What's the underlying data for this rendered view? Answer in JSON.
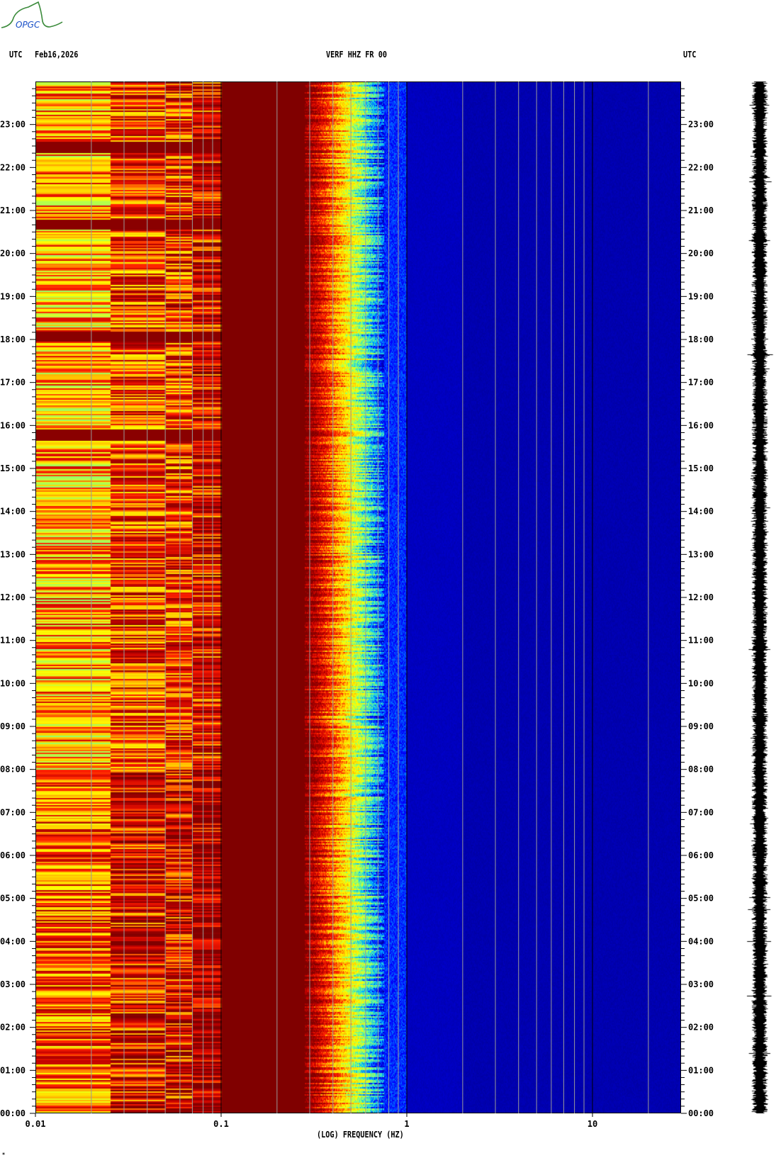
{
  "logo": {
    "text": "OPGC",
    "colors": {
      "curve": "#3a8a3a",
      "text": "#1a50c8"
    }
  },
  "header": {
    "left_tz": "UTC",
    "date": "Feb16,2026",
    "station": "VERF HHZ FR 00",
    "right_tz": "UTC"
  },
  "footer_mark": "*",
  "chart_data": {
    "type": "heatmap",
    "title": "VERF HHZ FR 00",
    "date": "Feb16,2026",
    "xlabel": "(LOG) FREQUENCY (HZ)",
    "xscale": "log",
    "xlim": [
      0.01,
      30
    ],
    "xticks": [
      {
        "value": 0.01,
        "label": "0.01"
      },
      {
        "value": 0.1,
        "label": "0.1"
      },
      {
        "value": 1,
        "label": "1"
      },
      {
        "value": 10,
        "label": "10"
      }
    ],
    "ylabel": "UTC",
    "ylim_hours": [
      0,
      24
    ],
    "yticks": [
      "00:00",
      "01:00",
      "02:00",
      "03:00",
      "04:00",
      "05:00",
      "06:00",
      "07:00",
      "08:00",
      "09:00",
      "10:00",
      "11:00",
      "12:00",
      "13:00",
      "14:00",
      "15:00",
      "16:00",
      "17:00",
      "18:00",
      "19:00",
      "20:00",
      "21:00",
      "22:00",
      "23:00"
    ],
    "minor_tick_minutes": 10,
    "colorscale": [
      "#0000a0",
      "#0000ff",
      "#00c0ff",
      "#80ff80",
      "#ffff00",
      "#ffc000",
      "#ff2000",
      "#c00000",
      "#800000"
    ],
    "bands": [
      {
        "fmin": 0.01,
        "fmax": 0.025,
        "level": 0.62
      },
      {
        "fmin": 0.025,
        "fmax": 0.05,
        "level": 0.74
      },
      {
        "fmin": 0.05,
        "fmax": 0.07,
        "level": 0.76
      },
      {
        "fmin": 0.07,
        "fmax": 0.1,
        "level": 0.84
      },
      {
        "fmin": 0.1,
        "fmax": 0.28,
        "level": 1.0
      },
      {
        "fmin": 0.28,
        "fmax": 0.4,
        "level": 0.8
      },
      {
        "fmin": 0.4,
        "fmax": 0.75,
        "level": 0.35
      },
      {
        "fmin": 0.75,
        "fmax": 1.0,
        "level": 0.12
      },
      {
        "fmin": 1.0,
        "fmax": 30,
        "level": 0.04
      }
    ],
    "strong_rows_hours": [
      22.5,
      20.7,
      18.1,
      15.8
    ],
    "gridlines": true
  }
}
